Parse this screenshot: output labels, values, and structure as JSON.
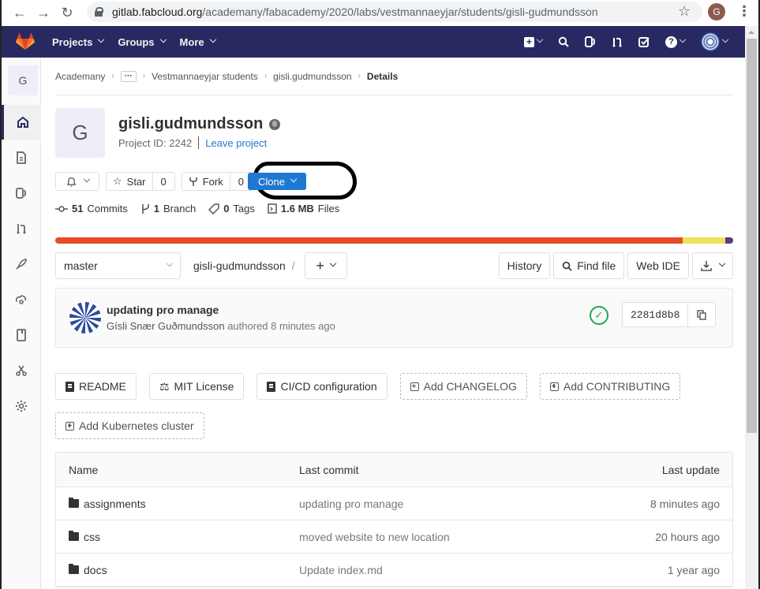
{
  "browser": {
    "url_host": "gitlab.fabcloud.org",
    "url_path": "/academany/fabacademy/2020/labs/vestmannaeyjar/students/gisli-gudmundsson",
    "profile_initial": "G"
  },
  "header": {
    "nav": [
      {
        "label": "Projects"
      },
      {
        "label": "Groups"
      },
      {
        "label": "More"
      }
    ],
    "icons": [
      "plus-square-icon",
      "search-icon",
      "issues-icon",
      "merge-requests-icon",
      "todo-icon",
      "help-icon",
      "user-avatar"
    ]
  },
  "sidebar": {
    "project_initial": "G",
    "items": [
      {
        "name": "project-overview",
        "icon": "home-icon",
        "active": true
      },
      {
        "name": "repository",
        "icon": "file-icon"
      },
      {
        "name": "issues",
        "icon": "issues-icon"
      },
      {
        "name": "merge-requests",
        "icon": "merge-request-icon"
      },
      {
        "name": "ci-cd",
        "icon": "rocket-icon"
      },
      {
        "name": "operations",
        "icon": "cloud-gear-icon"
      },
      {
        "name": "wiki",
        "icon": "book-icon"
      },
      {
        "name": "snippets",
        "icon": "scissors-icon"
      },
      {
        "name": "settings",
        "icon": "gear-icon"
      }
    ]
  },
  "breadcrumbs": {
    "items": [
      "Academany",
      "···",
      "Vestmannaeyjar students",
      "gisli.gudmundsson"
    ],
    "current": "Details"
  },
  "project": {
    "avatar_initial": "G",
    "title": "gisli.gudmundsson",
    "project_id": "Project ID: 2242",
    "leave_label": "Leave project"
  },
  "actions": {
    "star_label": "Star",
    "star_count": "0",
    "fork_label": "Fork",
    "fork_count": "0",
    "clone_label": "Clone"
  },
  "stats": {
    "commits_count": "51",
    "commits_label": "Commits",
    "branch_count": "1",
    "branch_label": "Branch",
    "tags_count": "0",
    "tags_label": "Tags",
    "files_size": "1.6 MB",
    "files_label": "Files"
  },
  "languages": [
    {
      "color": "#e44d26",
      "share": 92.5
    },
    {
      "color": "#f1e05a",
      "share": 6.3
    },
    {
      "color": "#563d7c",
      "share": 1.2
    }
  ],
  "repo_bar": {
    "branch": "master",
    "path": "gisli-gudmundsson",
    "history_label": "History",
    "find_file_label": "Find file",
    "web_ide_label": "Web IDE"
  },
  "last_commit": {
    "title": "updating pro manage",
    "author": "Gísli Snær Guðmundsson",
    "authored": "authored 8 minutes ago",
    "status": "passed",
    "sha": "2281d8b8"
  },
  "shortcuts": [
    {
      "label": "README",
      "icon": "file-icon",
      "dashed": false
    },
    {
      "label": "MIT License",
      "icon": "scale-icon",
      "dashed": false
    },
    {
      "label": "CI/CD configuration",
      "icon": "file-icon",
      "dashed": false
    },
    {
      "label": "Add CHANGELOG",
      "icon": "plus-square-icon",
      "dashed": true
    },
    {
      "label": "Add CONTRIBUTING",
      "icon": "plus-square-icon",
      "dashed": true
    },
    {
      "label": "Add Kubernetes cluster",
      "icon": "plus-square-icon",
      "dashed": true
    }
  ],
  "tree": {
    "headers": {
      "name": "Name",
      "last_commit": "Last commit",
      "last_update": "Last update"
    },
    "rows": [
      {
        "name": "assignments",
        "commit": "updating pro manage",
        "date": "8 minutes ago"
      },
      {
        "name": "css",
        "commit": "moved website to new location",
        "date": "20 hours ago"
      },
      {
        "name": "docs",
        "commit": "Update index.md",
        "date": "1 year ago"
      }
    ]
  }
}
